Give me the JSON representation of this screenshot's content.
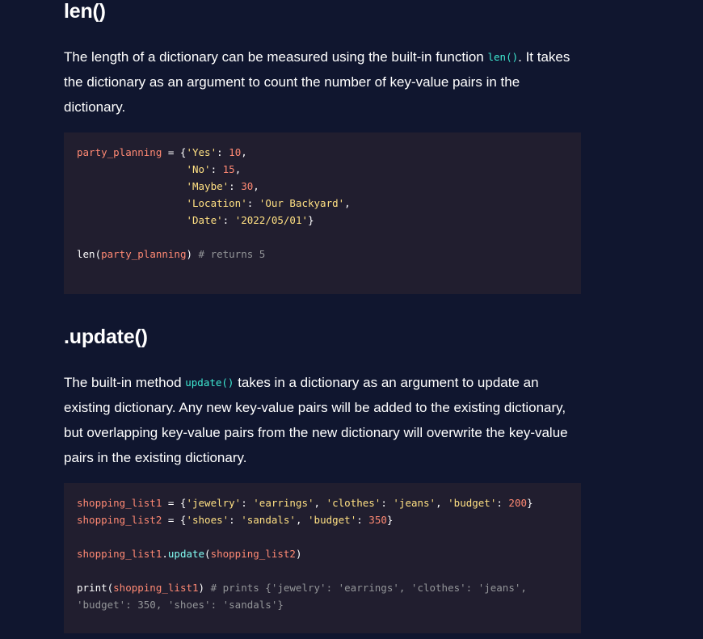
{
  "len_section": {
    "heading": "len()",
    "para_before": "The length of a dictionary can be measured using the built-in function ",
    "inline_code": "len()",
    "para_after": ". It takes the dictionary as an argument to count the number of key-value pairs in the dictionary.",
    "code_lines": [
      [
        {
          "t": "var",
          "v": "party_planning"
        },
        {
          "t": "pl",
          "v": " = {"
        },
        {
          "t": "str",
          "v": "'Yes'"
        },
        {
          "t": "pl",
          "v": ": "
        },
        {
          "t": "num",
          "v": "10"
        },
        {
          "t": "pl",
          "v": ","
        }
      ],
      [
        {
          "t": "pl",
          "v": "                  "
        },
        {
          "t": "str",
          "v": "'No'"
        },
        {
          "t": "pl",
          "v": ": "
        },
        {
          "t": "num",
          "v": "15"
        },
        {
          "t": "pl",
          "v": ","
        }
      ],
      [
        {
          "t": "pl",
          "v": "                  "
        },
        {
          "t": "str",
          "v": "'Maybe'"
        },
        {
          "t": "pl",
          "v": ": "
        },
        {
          "t": "num",
          "v": "30"
        },
        {
          "t": "pl",
          "v": ","
        }
      ],
      [
        {
          "t": "pl",
          "v": "                  "
        },
        {
          "t": "str",
          "v": "'Location'"
        },
        {
          "t": "pl",
          "v": ": "
        },
        {
          "t": "str",
          "v": "'Our Backyard'"
        },
        {
          "t": "pl",
          "v": ","
        }
      ],
      [
        {
          "t": "pl",
          "v": "                  "
        },
        {
          "t": "str",
          "v": "'Date'"
        },
        {
          "t": "pl",
          "v": ": "
        },
        {
          "t": "str",
          "v": "'2022/05/01'"
        },
        {
          "t": "pl",
          "v": "}"
        }
      ],
      [],
      [
        {
          "t": "pl",
          "v": "len("
        },
        {
          "t": "var",
          "v": "party_planning"
        },
        {
          "t": "pl",
          "v": ") "
        },
        {
          "t": "com",
          "v": "# returns 5"
        }
      ]
    ]
  },
  "update_section": {
    "heading": ".update()",
    "para_before": "The built-in method ",
    "inline_code": "update()",
    "para_after": " takes in a dictionary as an argument to update an existing dictionary. Any new key-value pairs will be added to the existing dictionary, but overlapping key-value pairs from the new dictionary will overwrite the key-value pairs in the existing dictionary.",
    "code_lines": [
      [
        {
          "t": "var",
          "v": "shopping_list1"
        },
        {
          "t": "pl",
          "v": " = {"
        },
        {
          "t": "str",
          "v": "'jewelry'"
        },
        {
          "t": "pl",
          "v": ": "
        },
        {
          "t": "str",
          "v": "'earrings'"
        },
        {
          "t": "pl",
          "v": ", "
        },
        {
          "t": "str",
          "v": "'clothes'"
        },
        {
          "t": "pl",
          "v": ": "
        },
        {
          "t": "str",
          "v": "'jeans'"
        },
        {
          "t": "pl",
          "v": ", "
        },
        {
          "t": "str",
          "v": "'budget'"
        },
        {
          "t": "pl",
          "v": ": "
        },
        {
          "t": "num",
          "v": "200"
        },
        {
          "t": "pl",
          "v": "}"
        }
      ],
      [
        {
          "t": "var",
          "v": "shopping_list2"
        },
        {
          "t": "pl",
          "v": " = {"
        },
        {
          "t": "str",
          "v": "'shoes'"
        },
        {
          "t": "pl",
          "v": ": "
        },
        {
          "t": "str",
          "v": "'sandals'"
        },
        {
          "t": "pl",
          "v": ", "
        },
        {
          "t": "str",
          "v": "'budget'"
        },
        {
          "t": "pl",
          "v": ": "
        },
        {
          "t": "num",
          "v": "350"
        },
        {
          "t": "pl",
          "v": "}"
        }
      ],
      [],
      [
        {
          "t": "var",
          "v": "shopping_list1"
        },
        {
          "t": "pl",
          "v": "."
        },
        {
          "t": "fn",
          "v": "update"
        },
        {
          "t": "pl",
          "v": "("
        },
        {
          "t": "var",
          "v": "shopping_list2"
        },
        {
          "t": "pl",
          "v": ")"
        }
      ],
      [],
      [
        {
          "t": "pl",
          "v": "print("
        },
        {
          "t": "var",
          "v": "shopping_list1"
        },
        {
          "t": "pl",
          "v": ") "
        },
        {
          "t": "com",
          "v": "# prints {'jewelry': 'earrings', 'clothes': 'jeans',"
        }
      ],
      [
        {
          "t": "com",
          "v": "'budget': 350, 'shoes': 'sandals'}"
        }
      ]
    ]
  }
}
